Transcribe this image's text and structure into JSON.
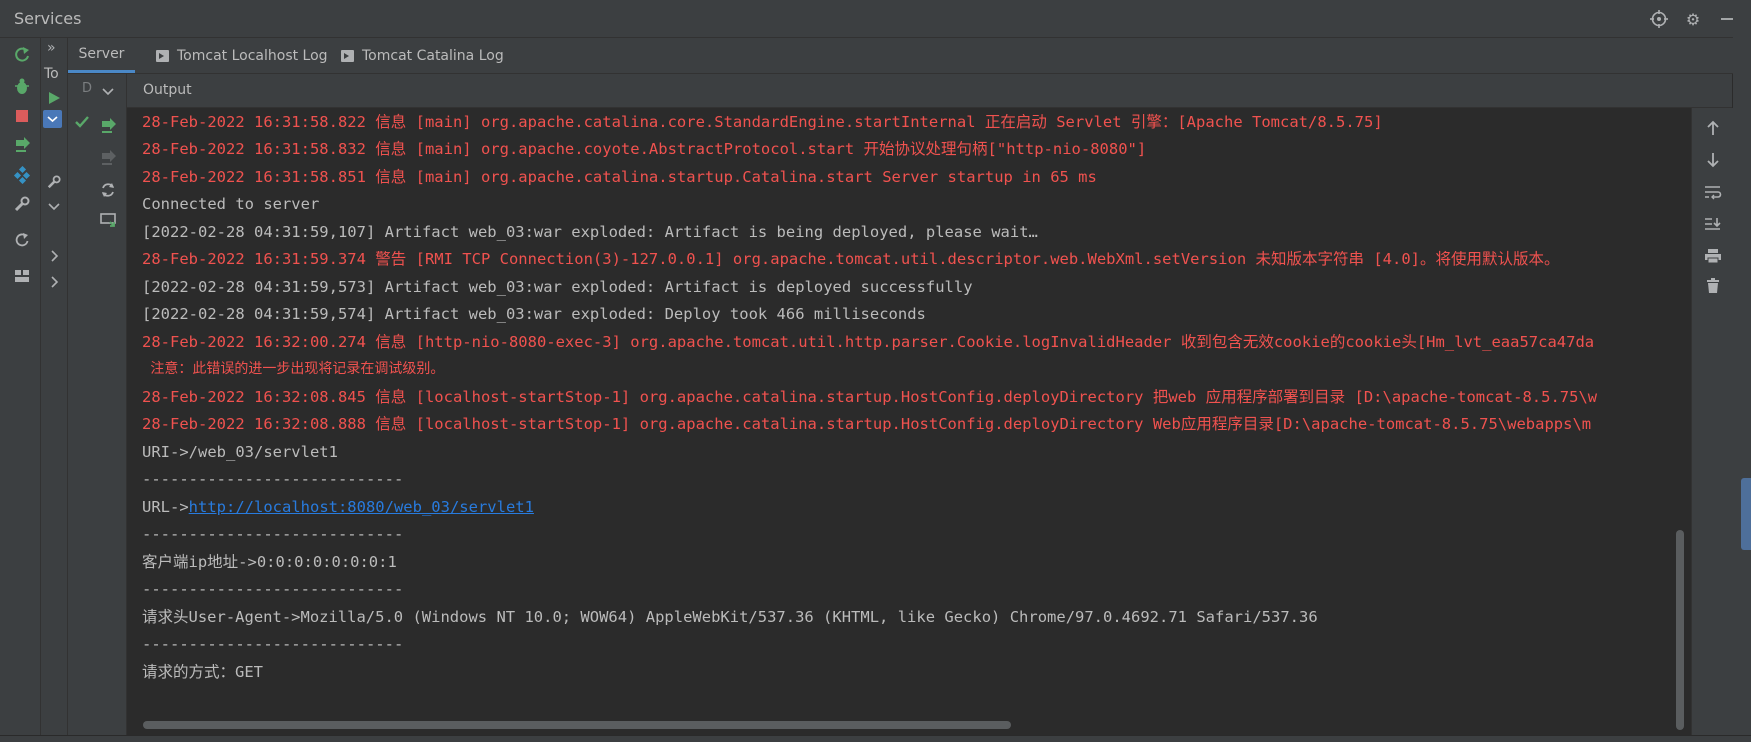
{
  "window": {
    "title": "Services"
  },
  "title_icons": [
    "crosshair-icon",
    "gear-icon",
    "minimize-icon"
  ],
  "tabs": [
    {
      "label": "Server",
      "active": true
    },
    {
      "label": "Tomcat Localhost Log",
      "icon": "console-icon"
    },
    {
      "label": "Tomcat Catalina Log",
      "icon": "console-icon"
    }
  ],
  "tree": {
    "root_label": "To",
    "chevron": "»",
    "collapsed_label": "D"
  },
  "output_header": "Output",
  "colors": {
    "error": "#f0524f",
    "normal": "#bbbbbb",
    "link": "#287bde",
    "run": "#59a869",
    "stop": "#db5c5c"
  },
  "console": {
    "lines": [
      {
        "style": "red",
        "text": "28-Feb-2022 16:31:58.822 信息 [main] org.apache.catalina.core.StandardEngine.startInternal 正在启动 Servlet 引擎：[Apache Tomcat/8.5.75]"
      },
      {
        "style": "red",
        "text": "28-Feb-2022 16:31:58.832 信息 [main] org.apache.coyote.AbstractProtocol.start 开始协议处理句柄[\"http-nio-8080\"]"
      },
      {
        "style": "red",
        "text": "28-Feb-2022 16:31:58.851 信息 [main] org.apache.catalina.startup.Catalina.start Server startup in 65 ms"
      },
      {
        "style": "norm",
        "text": "Connected to server"
      },
      {
        "style": "norm",
        "text": "[2022-02-28 04:31:59,107] Artifact web_03:war exploded: Artifact is being deployed, please wait…"
      },
      {
        "style": "red",
        "text": "28-Feb-2022 16:31:59.374 警告 [RMI TCP Connection(3)-127.0.0.1] org.apache.tomcat.util.descriptor.web.WebXml.setVersion 未知版本字符串 [4.0]。将使用默认版本。"
      },
      {
        "style": "norm",
        "text": "[2022-02-28 04:31:59,573] Artifact web_03:war exploded: Artifact is deployed successfully"
      },
      {
        "style": "norm",
        "text": "[2022-02-28 04:31:59,574] Artifact web_03:war exploded: Deploy took 466 milliseconds"
      },
      {
        "style": "red",
        "text": "28-Feb-2022 16:32:00.274 信息 [http-nio-8080-exec-3] org.apache.tomcat.util.http.parser.Cookie.logInvalidHeader 收到包含无效cookie的cookie头[Hm_lvt_eaa57ca47da"
      },
      {
        "style": "red",
        "text": " 注意：此错误的进一步出现将记录在调试级别。"
      },
      {
        "style": "red",
        "text": "28-Feb-2022 16:32:08.845 信息 [localhost-startStop-1] org.apache.catalina.startup.HostConfig.deployDirectory 把web 应用程序部署到目录 [D:\\apache-tomcat-8.5.75\\w"
      },
      {
        "style": "red",
        "text": "28-Feb-2022 16:32:08.888 信息 [localhost-startStop-1] org.apache.catalina.startup.HostConfig.deployDirectory Web应用程序目录[D:\\apache-tomcat-8.5.75\\webapps\\m"
      },
      {
        "style": "norm",
        "text": "URI->/web_03/servlet1"
      },
      {
        "style": "norm",
        "text": "----------------------------"
      },
      {
        "style": "norm",
        "text": "URL->",
        "link": "http://localhost:8080/web_03/servlet1"
      },
      {
        "style": "norm",
        "text": "----------------------------"
      },
      {
        "style": "norm",
        "text": "客户端ip地址->0:0:0:0:0:0:0:1"
      },
      {
        "style": "norm",
        "text": "----------------------------"
      },
      {
        "style": "norm",
        "text": "请求头User-Agent->Mozilla/5.0 (Windows NT 10.0; WOW64) AppleWebKit/537.36 (KHTML, like Gecko) Chrome/97.0.4692.71 Safari/537.36"
      },
      {
        "style": "norm",
        "text": "----------------------------"
      },
      {
        "style": "norm",
        "text": "请求的方式：GET"
      }
    ]
  },
  "right_toolbar": [
    "scroll-up-icon",
    "scroll-down-icon",
    "soft-wrap-icon",
    "scroll-to-end-icon",
    "print-icon",
    "clear-all-icon"
  ]
}
